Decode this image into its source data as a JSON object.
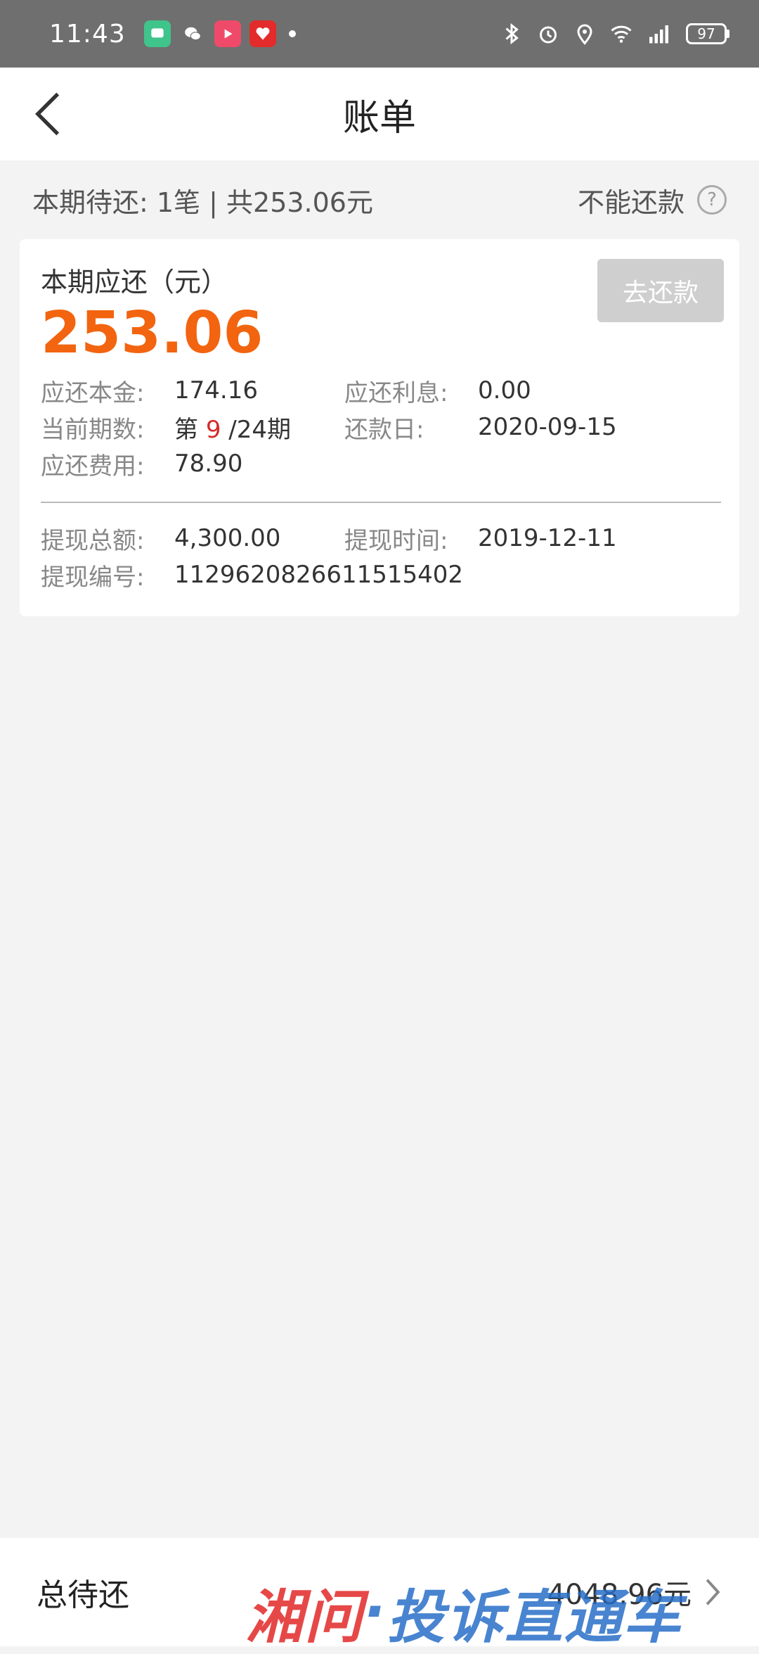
{
  "status_bar": {
    "time": "11:43",
    "battery": "97",
    "icons": [
      "message-app-icon",
      "wechat-icon",
      "video-app-icon",
      "shopping-app-icon",
      "notification-dot",
      "bluetooth-icon",
      "alarm-icon",
      "location-icon",
      "wifi-icon",
      "signal-4g-icon",
      "battery-icon"
    ]
  },
  "nav": {
    "title": "账单"
  },
  "summary": {
    "text": "本期待还: 1笔 | 共253.06元",
    "cannot_repay": "不能还款",
    "help_glyph": "?"
  },
  "card": {
    "title": "本期应还（元）",
    "amount": "253.06",
    "pay_button": "去还款",
    "principal_label": "应还本金:",
    "principal_value": "174.16",
    "interest_label": "应还利息:",
    "interest_value": "0.00",
    "period_label": "当前期数:",
    "period_prefix": "第 ",
    "period_current": "9",
    "period_suffix": " /24期",
    "due_date_label": "还款日:",
    "due_date_value": "2020-09-15",
    "fee_label": "应还费用:",
    "fee_value": "78.90",
    "withdraw_total_label": "提现总额:",
    "withdraw_total_value": "4,300.00",
    "withdraw_time_label": "提现时间:",
    "withdraw_time_value": "2019-12-11",
    "withdraw_no_label": "提现编号:",
    "withdraw_no_value": "1129620826611515402"
  },
  "bottom": {
    "label": "总待还",
    "total": "4048.96元"
  },
  "watermark": {
    "part1": "湘问",
    "sep": "·",
    "part2": "投诉直通车"
  },
  "colors": {
    "accent": "#f2640f",
    "highlight": "#d62a2a",
    "disabled_button": "#cfcfcf"
  }
}
